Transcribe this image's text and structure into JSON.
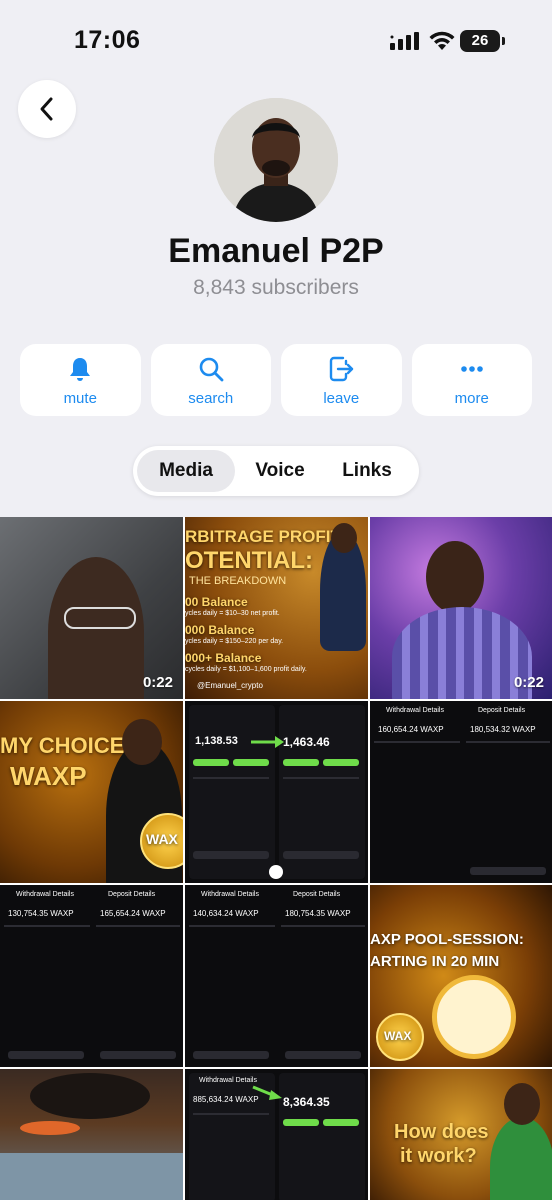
{
  "status_bar": {
    "time": "17:06",
    "battery": "26"
  },
  "channel": {
    "name": "Emanuel P2P",
    "subscribers": "8,843 subscribers"
  },
  "actions": [
    {
      "label": "mute",
      "icon": "bell-icon"
    },
    {
      "label": "search",
      "icon": "search-icon"
    },
    {
      "label": "leave",
      "icon": "leave-icon"
    },
    {
      "label": "more",
      "icon": "more-icon"
    }
  ],
  "tabs": [
    "Media",
    "Voice",
    "Links"
  ],
  "media": {
    "video1_duration": "0:22",
    "video2_duration": "0:22",
    "promo1": {
      "line1": "RBITRAGE PROFIT",
      "line2": "OTENTIAL:",
      "line3": "THE BREAKDOWN",
      "b1": "00 Balance",
      "b1s": "ycles daily = $10–30 net profit.",
      "b2": "000 Balance",
      "b2s": "ycles daily = $150–220 per day.",
      "b3": "000+ Balance",
      "b3s": "cycles daily = $1,100–1,600 profit daily.",
      "handle": "@Emanuel_crypto"
    },
    "promo2": {
      "line1": "MY CHOICE:",
      "line2": "WAXP",
      "coin": "WAX"
    },
    "shot1": {
      "left_amount": "1,138.53",
      "right_amount": "1,463.46"
    },
    "shot2": {
      "title_left": "Withdrawal Details",
      "title_right": "Deposit Details",
      "amt_left": "160,654.24 WAXP",
      "amt_right": "180,534.32 WAXP"
    },
    "shot3": {
      "title_left": "Withdrawal Details",
      "title_right": "Deposit Details",
      "amt_left": "130,754.35 WAXP",
      "amt_right": "165,654.24 WAXP"
    },
    "shot4": {
      "title_left": "Withdrawal Details",
      "title_right": "Deposit Details",
      "amt_left": "140,634.24 WAXP",
      "amt_right": "180,754.35 WAXP"
    },
    "promo3": {
      "line1": "AXP POOL-SESSION:",
      "line2": "ARTING IN 20 MIN",
      "coin": "WAX"
    },
    "shot5": {
      "title_left": "Withdrawal Details",
      "amt_left": "885,634.24 WAXP",
      "right_amount": "8,364.35"
    },
    "promo4": {
      "line1": "How does",
      "line2": "it work?"
    }
  }
}
